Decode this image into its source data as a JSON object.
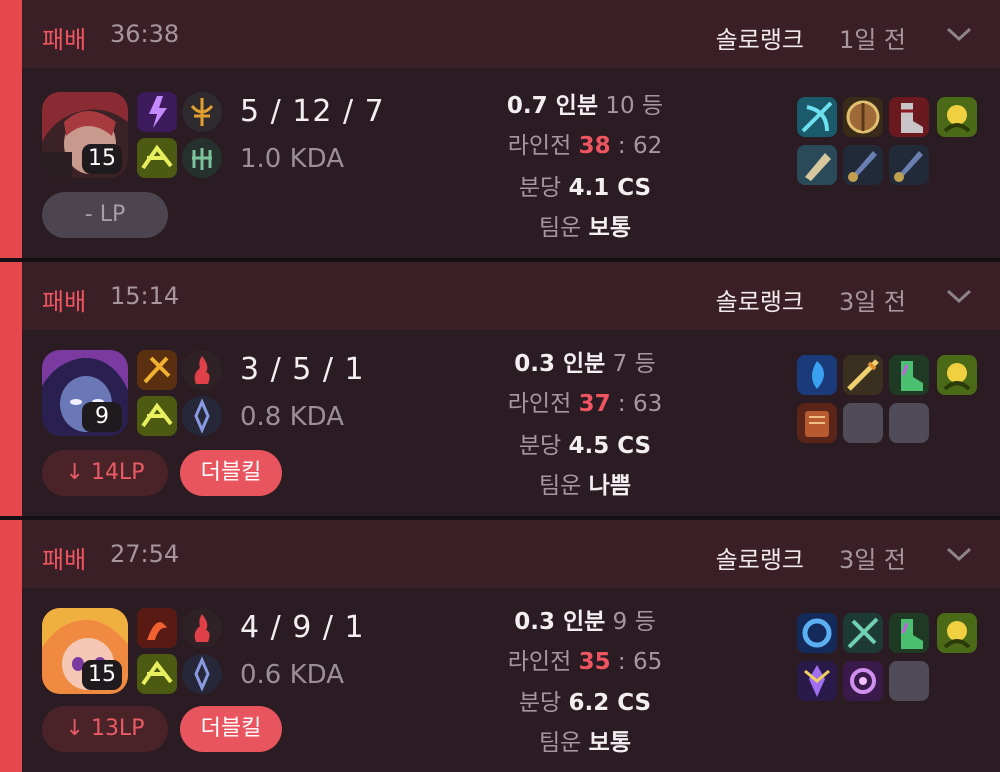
{
  "matches": [
    {
      "result": "패배",
      "duration": "36:38",
      "queue": "솔로랭크",
      "ago": "1일 전",
      "champion": "champion-portrait-1",
      "level": "15",
      "kda": "5 / 12 / 7",
      "kda_ratio": "1.0 KDA",
      "lp": "- LP",
      "tag": "",
      "perf": "0.7 인분",
      "rank": "10 등",
      "lane_label": "라인전",
      "lane_mine": "38",
      "lane_sep": " : ",
      "lane_theirs": "62",
      "cs_label": "분당",
      "cs": "4.1 CS",
      "luck_label": "팀운",
      "luck": "보통"
    },
    {
      "result": "패배",
      "duration": "15:14",
      "queue": "솔로랭크",
      "ago": "3일 전",
      "champion": "champion-portrait-2",
      "level": "9",
      "kda": "3 / 5 / 1",
      "kda_ratio": "0.8 KDA",
      "lp": "↓ 14LP",
      "tag": "더블킬",
      "perf": "0.3 인분",
      "rank": "7 등",
      "lane_label": "라인전",
      "lane_mine": "37",
      "lane_sep": " : ",
      "lane_theirs": "63",
      "cs_label": "분당",
      "cs": "4.5 CS",
      "luck_label": "팀운",
      "luck": "나쁨"
    },
    {
      "result": "패배",
      "duration": "27:54",
      "queue": "솔로랭크",
      "ago": "3일 전",
      "champion": "champion-portrait-3",
      "level": "15",
      "kda": "4 / 9 / 1",
      "kda_ratio": "0.6 KDA",
      "lp": "↓ 13LP",
      "tag": "더블킬",
      "perf": "0.3 인분",
      "rank": "9 등",
      "lane_label": "라인전",
      "lane_mine": "35",
      "lane_sep": " : ",
      "lane_theirs": "65",
      "cs_label": "분당",
      "cs": "6.2 CS",
      "luck_label": "팀운",
      "luck": "보통"
    }
  ],
  "colors": {
    "loss": "#e5484d",
    "header_bg": "#3b1f27",
    "card_bg": "#2a1c22"
  }
}
